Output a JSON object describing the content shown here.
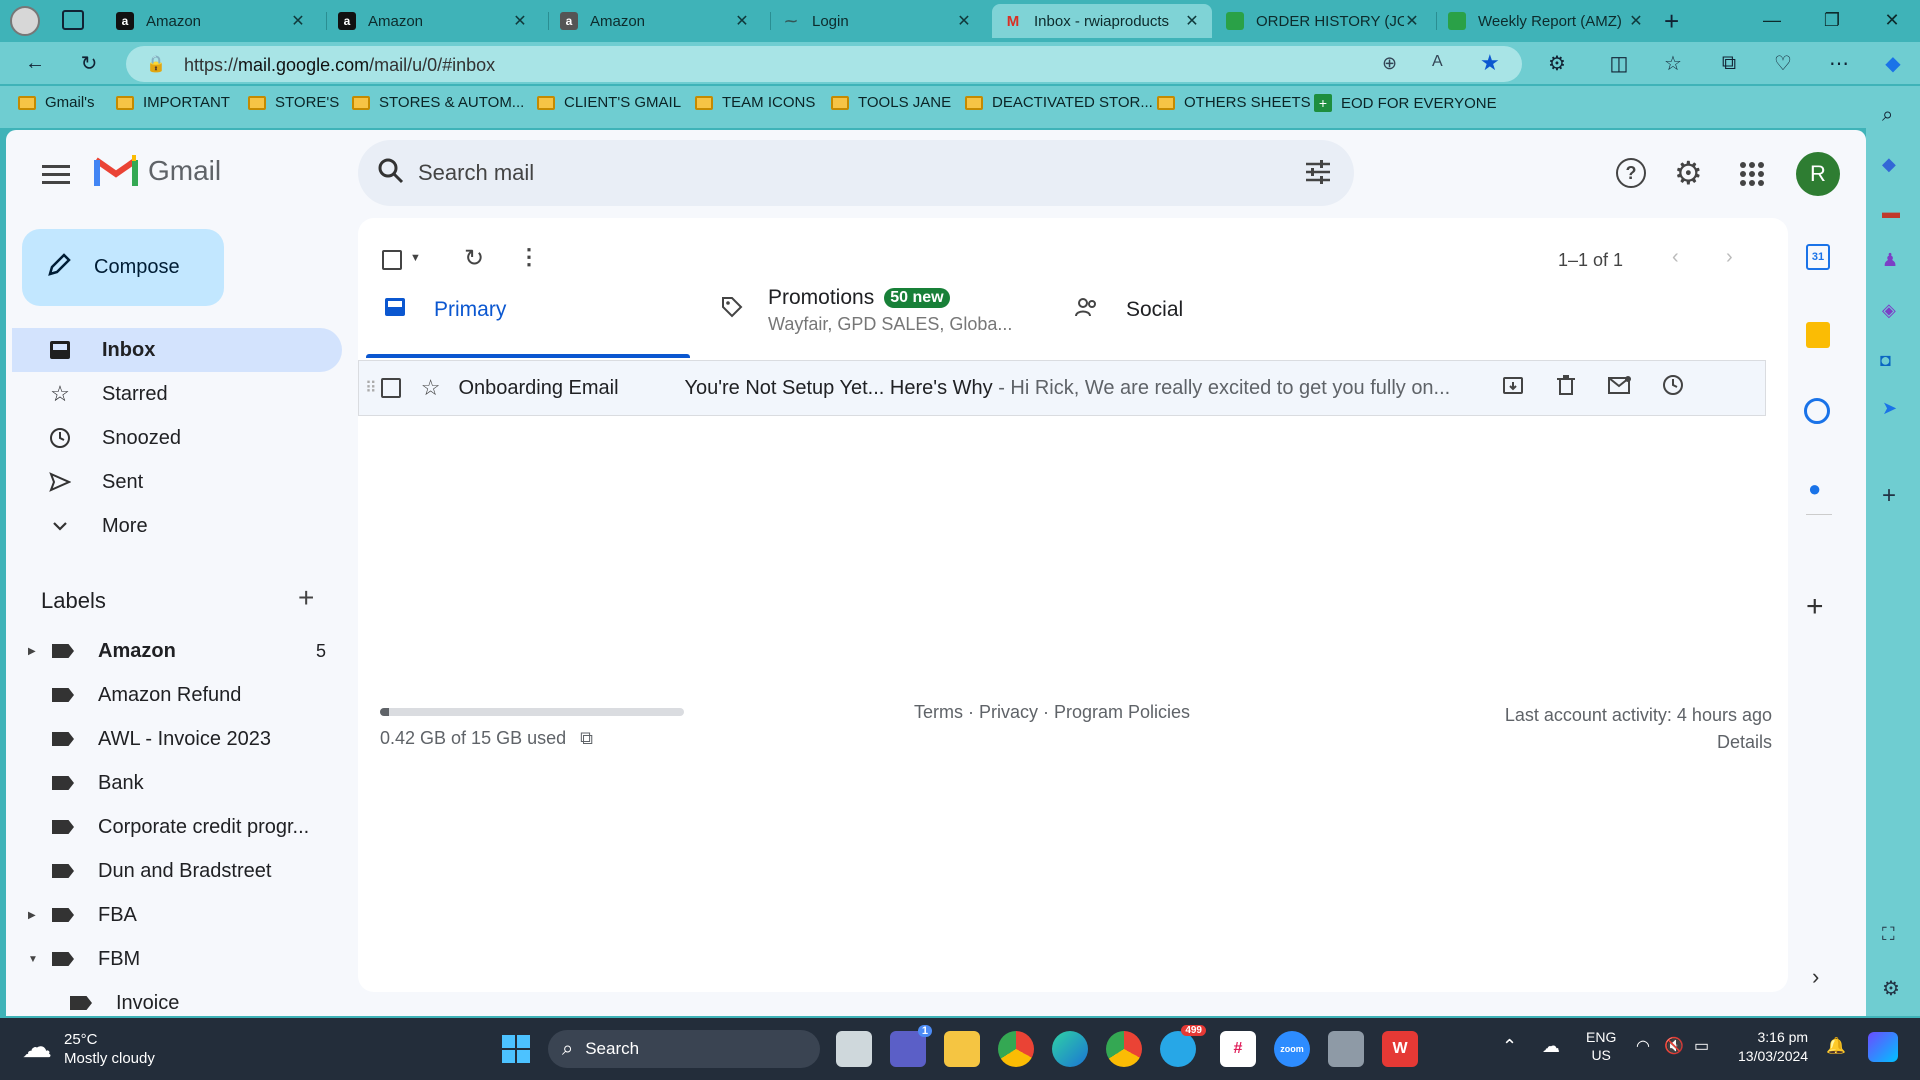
{
  "browser": {
    "tabs": [
      {
        "title": "Amazon",
        "icon": "amazon-icon"
      },
      {
        "title": "Amazon",
        "icon": "amazon-icon"
      },
      {
        "title": "Amazon",
        "icon": "amazon-icon"
      },
      {
        "title": "Login",
        "icon": "login-icon"
      },
      {
        "title": "Inbox - rwiaproducts",
        "icon": "gmail-icon",
        "active": true
      },
      {
        "title": "ORDER HISTORY (JOS",
        "icon": "sheets-icon"
      },
      {
        "title": "Weekly Report (AMZ)",
        "icon": "sheets-icon"
      }
    ],
    "url_prefix": "https://",
    "url_host": "mail.google.com",
    "url_path": "/mail/u/0/#inbox",
    "bookmarks": [
      "Gmail's",
      "IMPORTANT",
      "STORE'S",
      "STORES & AUTOM...",
      "CLIENT'S GMAIL",
      "TEAM ICONS",
      "TOOLS JANE",
      "DEACTIVATED STOR...",
      "OTHERS SHEETS",
      "EOD FOR EVERYONE"
    ]
  },
  "gmail": {
    "logo_text": "Gmail",
    "search_placeholder": "Search mail",
    "avatar_letter": "R",
    "compose_label": "Compose",
    "nav": [
      {
        "label": "Inbox",
        "icon": "inbox-icon",
        "selected": true
      },
      {
        "label": "Starred",
        "icon": "star-icon"
      },
      {
        "label": "Snoozed",
        "icon": "clock-icon"
      },
      {
        "label": "Sent",
        "icon": "send-icon"
      },
      {
        "label": "More",
        "icon": "chevron-down-icon"
      }
    ],
    "labels_heading": "Labels",
    "labels": [
      {
        "label": "Amazon",
        "count": "5",
        "bold": true,
        "expander": "right"
      },
      {
        "label": "Amazon Refund"
      },
      {
        "label": "AWL - Invoice 2023"
      },
      {
        "label": "Bank"
      },
      {
        "label": "Corporate credit progr..."
      },
      {
        "label": "Dun and Bradstreet"
      },
      {
        "label": "FBA",
        "expander": "right"
      },
      {
        "label": "FBM",
        "expander": "down"
      },
      {
        "label": "Invoice",
        "indent": true
      }
    ],
    "pagination": "1–1 of 1",
    "categories": {
      "primary": "Primary",
      "promotions": "Promotions",
      "promotions_badge": "50 new",
      "promotions_sub": "Wayfair, GPD SALES, Globa...",
      "social": "Social"
    },
    "email": {
      "sender": "Onboarding Email",
      "subject": "You're Not Setup Yet... Here's Why",
      "snippet": " - Hi Rick, We are really excited to get you fully on..."
    },
    "footer": {
      "storage": "0.42 GB of 15 GB used",
      "storage_fraction": 0.028,
      "terms": "Terms",
      "privacy": "Privacy",
      "policies": "Program Policies",
      "sep": " · ",
      "activity": "Last account activity: 4 hours ago",
      "details": "Details"
    }
  },
  "taskbar": {
    "weather_temp": "25°C",
    "weather_desc": "Mostly cloudy",
    "search_label": "Search",
    "lang1": "ENG",
    "lang2": "US",
    "time": "3:16 pm",
    "date": "13/03/2024",
    "teams_badge": "1",
    "telegram_badge": "499"
  },
  "colors": {
    "browser_chrome": "#3fb3b8",
    "accent_blue": "#0b57d0",
    "badge_green": "#188038"
  }
}
